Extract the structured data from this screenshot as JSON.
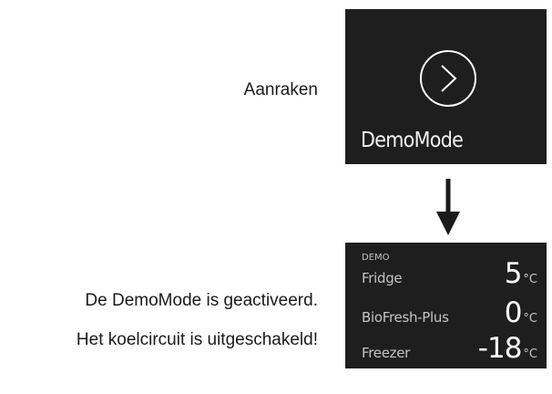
{
  "instructions": {
    "touch_label": "Aanraken",
    "activated_text": "De DemoMode is geactiveerd.",
    "circuit_off_text": "Het koelcircuit is uitgeschakeld!"
  },
  "demo_tile": {
    "label": "DemoMode",
    "icon": "chevron-right-circle-icon"
  },
  "arrow_icon": "arrow-down-icon",
  "status_panel": {
    "demo_tag": "DEMO",
    "zones": [
      {
        "name": "Fridge",
        "temperature": "5",
        "unit": "°C"
      },
      {
        "name": "BioFresh-Plus",
        "temperature": "0",
        "unit": "°C"
      },
      {
        "name": "Freezer",
        "temperature": "-18",
        "unit": "°C"
      }
    ]
  },
  "colors": {
    "panel_background": "#1e1e1e",
    "panel_text": "#ffffff",
    "secondary_text": "#c4c4c4",
    "page_background": "#ffffff"
  }
}
